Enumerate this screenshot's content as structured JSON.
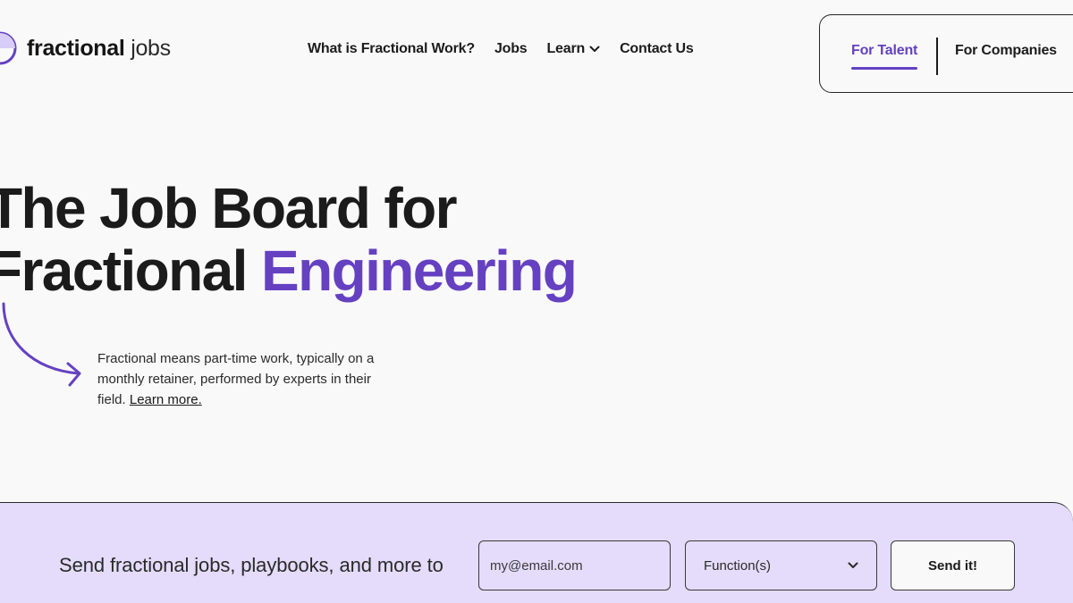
{
  "header": {
    "logo": {
      "bold": "fractional",
      "light": "jobs"
    },
    "nav": [
      {
        "label": "What is Fractional Work?"
      },
      {
        "label": "Jobs"
      },
      {
        "label": "Learn"
      },
      {
        "label": "Contact Us"
      }
    ],
    "toggle": {
      "talent": "For Talent",
      "companies": "For Companies",
      "active": "talent"
    }
  },
  "hero": {
    "title_line1": "The Job Board for",
    "title_line2_plain": "Fractional",
    "title_line2_accent": "Engineering",
    "description": "Fractional means part-time work, typically on a monthly retainer, performed by experts in their field.",
    "learn_more": "Learn more."
  },
  "newsletter": {
    "text": "Send fractional jobs, playbooks, and more to",
    "email_placeholder": "my@email.com",
    "function_select": "Function(s)",
    "submit": "Send it!"
  },
  "colors": {
    "accent": "#6541c1",
    "newsletter_bg": "#e4dcfa",
    "page_bg": "#f9f9fa"
  }
}
